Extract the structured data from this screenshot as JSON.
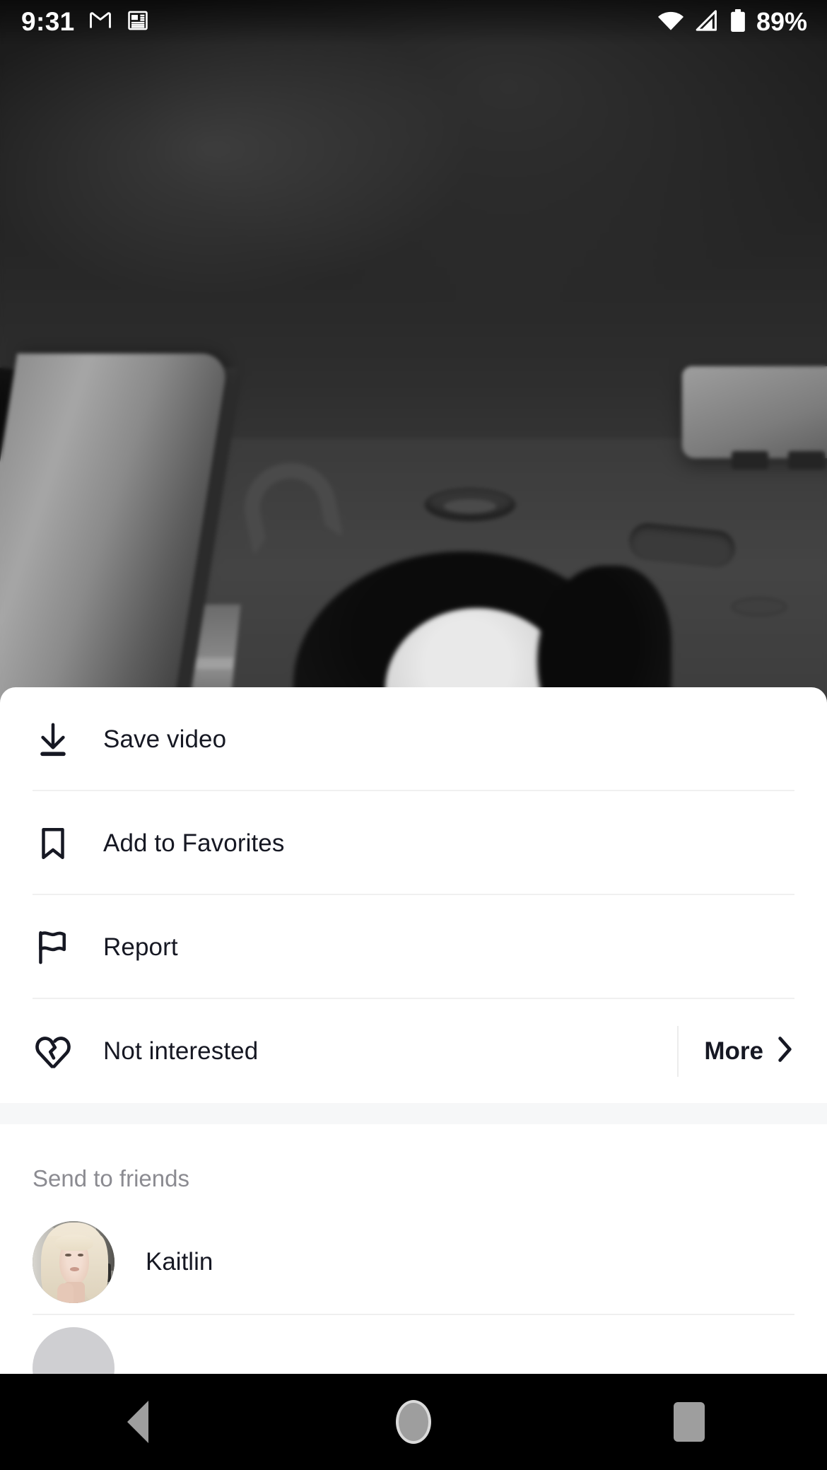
{
  "status_bar": {
    "time": "9:31",
    "left_icons": [
      "gmail-icon",
      "news-icon"
    ],
    "right_icons": [
      "wifi-icon",
      "cellular-signal-icon",
      "battery-icon"
    ],
    "battery_percent": "89%"
  },
  "video": {
    "description": "blurred dark car interior with headliner, sun visor and a person's head"
  },
  "sheet": {
    "menu_items": [
      {
        "icon": "download-icon",
        "label": "Save video"
      },
      {
        "icon": "bookmark-icon",
        "label": "Add to Favorites"
      },
      {
        "icon": "flag-icon",
        "label": "Report"
      },
      {
        "icon": "broken-heart-icon",
        "label": "Not interested",
        "trailing_label": "More",
        "trailing_icon": "chevron-right-icon"
      }
    ],
    "send_to_friends": {
      "title": "Send to friends",
      "friends": [
        {
          "name": "Kaitlin",
          "avatar": "photo"
        },
        {
          "name": "",
          "avatar": "placeholder"
        }
      ]
    }
  },
  "nav_bar": {
    "buttons": [
      {
        "name": "back",
        "icon": "triangle-back-icon"
      },
      {
        "name": "home",
        "icon": "circle-home-icon"
      },
      {
        "name": "recents",
        "icon": "square-recents-icon"
      }
    ]
  },
  "colors": {
    "sheet_background": "#ffffff",
    "text_primary": "#161823",
    "text_secondary": "#8b8b91",
    "divider": "#f0f0f0",
    "band": "#f6f7f8",
    "nav_background": "#000000",
    "nav_icon": "#9e9e9e"
  }
}
